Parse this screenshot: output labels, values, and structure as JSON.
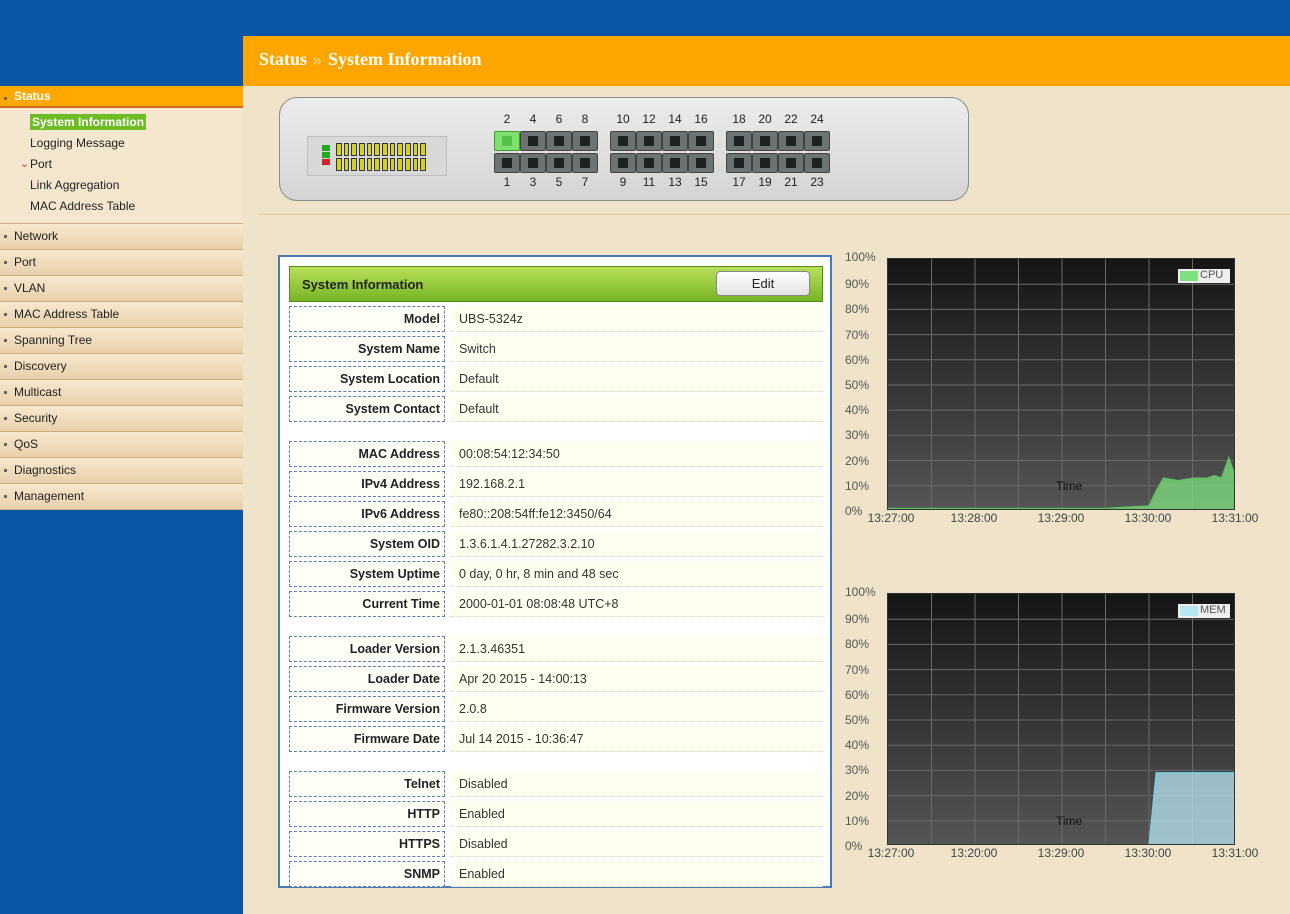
{
  "breadcrumb": {
    "section": "Status",
    "separator": "»",
    "page": "System Information"
  },
  "sidebar": {
    "items": [
      {
        "label": "Status",
        "active": true,
        "children": [
          {
            "label": "System Information",
            "selected": true
          },
          {
            "label": "Logging Message"
          },
          {
            "label": "Port",
            "expandable": true
          },
          {
            "label": "Link Aggregation"
          },
          {
            "label": "MAC Address Table"
          }
        ]
      },
      {
        "label": "Network"
      },
      {
        "label": "Port"
      },
      {
        "label": "VLAN"
      },
      {
        "label": "MAC Address Table"
      },
      {
        "label": "Spanning Tree"
      },
      {
        "label": "Discovery"
      },
      {
        "label": "Multicast"
      },
      {
        "label": "Security"
      },
      {
        "label": "QoS"
      },
      {
        "label": "Diagnostics"
      },
      {
        "label": "Management"
      }
    ]
  },
  "switch": {
    "top_ports": [
      "2",
      "4",
      "6",
      "8",
      "10",
      "12",
      "14",
      "16",
      "18",
      "20",
      "22",
      "24"
    ],
    "bottom_ports": [
      "1",
      "3",
      "5",
      "7",
      "9",
      "11",
      "13",
      "15",
      "17",
      "19",
      "21",
      "23"
    ],
    "link_up_ports": [
      "2"
    ]
  },
  "info": {
    "title": "System Information",
    "edit_label": "Edit",
    "groups": [
      [
        {
          "key": "Model",
          "value": "UBS-5324z"
        },
        {
          "key": "System Name",
          "value": "Switch"
        },
        {
          "key": "System Location",
          "value": "Default"
        },
        {
          "key": "System Contact",
          "value": "Default"
        }
      ],
      [
        {
          "key": "MAC Address",
          "value": "00:08:54:12:34:50"
        },
        {
          "key": "IPv4 Address",
          "value": "192.168.2.1"
        },
        {
          "key": "IPv6 Address",
          "value": "fe80::208:54ff:fe12:3450/64"
        },
        {
          "key": "System OID",
          "value": "1.3.6.1.4.1.27282.3.2.10"
        },
        {
          "key": "System Uptime",
          "value": "0 day, 0 hr, 8 min and 48 sec"
        },
        {
          "key": "Current Time",
          "value": "2000-01-01 08:08:48 UTC+8"
        }
      ],
      [
        {
          "key": "Loader Version",
          "value": "2.1.3.46351"
        },
        {
          "key": "Loader Date",
          "value": "Apr 20 2015 - 14:00:13"
        },
        {
          "key": "Firmware Version",
          "value": "2.0.8"
        },
        {
          "key": "Firmware Date",
          "value": "Jul 14 2015 - 10:36:47"
        }
      ],
      [
        {
          "key": "Telnet",
          "value": "Disabled"
        },
        {
          "key": "HTTP",
          "value": "Enabled"
        },
        {
          "key": "HTTPS",
          "value": "Disabled"
        },
        {
          "key": "SNMP",
          "value": "Enabled"
        }
      ]
    ]
  },
  "colors": {
    "cpu": "#7fe07f",
    "cpu_line": "#5fc05f",
    "mem": "#b8e6f2",
    "mem_line": "#7ccfe4"
  },
  "chart_data": [
    {
      "type": "area",
      "legend": "CPU",
      "xlabel": "Time",
      "ylim": [
        0,
        100
      ],
      "yticks": [
        "100%",
        "90%",
        "80%",
        "70%",
        "60%",
        "50%",
        "40%",
        "30%",
        "20%",
        "10%",
        "0%"
      ],
      "xticks": [
        "13:27:00",
        "13:28:00",
        "13:29:00",
        "13:30:00",
        "13:31:00"
      ],
      "x": [
        "13:27:00",
        "13:29:30",
        "13:30:00",
        "13:30:05",
        "13:30:10",
        "13:30:20",
        "13:30:30",
        "13:30:40",
        "13:30:45",
        "13:30:50",
        "13:30:55",
        "13:31:00"
      ],
      "values": [
        1,
        1,
        2,
        8,
        13,
        12,
        13,
        13,
        14,
        13,
        21,
        13
      ]
    },
    {
      "type": "area",
      "legend": "MEM",
      "xlabel": "Time",
      "ylim": [
        0,
        100
      ],
      "yticks": [
        "100%",
        "90%",
        "80%",
        "70%",
        "60%",
        "50%",
        "40%",
        "30%",
        "20%",
        "10%",
        "0%"
      ],
      "xticks": [
        "13:27:00",
        "13:20:00",
        "13:29:00",
        "13:30:00",
        "13:31:00"
      ],
      "x": [
        "13:30:00",
        "13:30:05",
        "13:31:00"
      ],
      "values": [
        0,
        29,
        29
      ]
    }
  ]
}
